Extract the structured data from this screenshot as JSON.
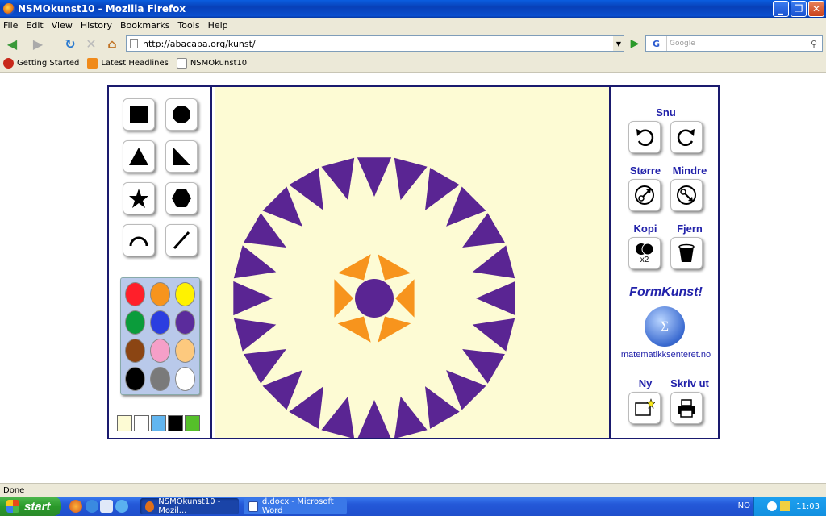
{
  "window": {
    "title": "NSMOkunst10 - Mozilla Firefox"
  },
  "menu": [
    "File",
    "Edit",
    "View",
    "History",
    "Bookmarks",
    "Tools",
    "Help"
  ],
  "nav": {
    "url": "http://abacaba.org/kunst/",
    "search_placeholder": "Google",
    "search_engine_label": "G"
  },
  "bookmarks": [
    {
      "label": "Getting Started",
      "icon": "firefox-icon"
    },
    {
      "label": "Latest Headlines",
      "icon": "rss-icon"
    },
    {
      "label": "NSMOkunst10",
      "icon": "page-icon"
    }
  ],
  "app": {
    "shape_tools": [
      "square",
      "circle",
      "triangle",
      "right-triangle",
      "star",
      "hexagon",
      "arc",
      "line"
    ],
    "colors": [
      "#ff1f2a",
      "#f7941d",
      "#fff200",
      "#0b9c3b",
      "#2b3ee0",
      "#5b2c9c",
      "#8b4513",
      "#f59fc8",
      "#fdc97e",
      "#000000",
      "#7a7a7a",
      "#ffffff"
    ],
    "background_colors": [
      "#fdfbd4",
      "#ffffff",
      "#62b6f0",
      "#000000",
      "#55c02a"
    ],
    "right": {
      "snu": "Snu",
      "storre": "Større",
      "mindre": "Mindre",
      "kopi": "Kopi",
      "kopi_badge": "x2",
      "fjern": "Fjern",
      "logo_title": "FormKunst!",
      "logo_url": "matematikksenteret.no",
      "ny": "Ny",
      "skriv_ut": "Skriv ut"
    },
    "artwork": {
      "ring_color": "#5a2593",
      "inner_color": "#f7941d",
      "triangle_count": 24,
      "inner_triangle_count": 6
    }
  },
  "status": "Done",
  "taskbar": {
    "start": "start",
    "tasks": [
      "NSMOkunst10 - Mozil...",
      "d.docx - Microsoft Word"
    ],
    "lang": "NO",
    "time": "11:03"
  }
}
